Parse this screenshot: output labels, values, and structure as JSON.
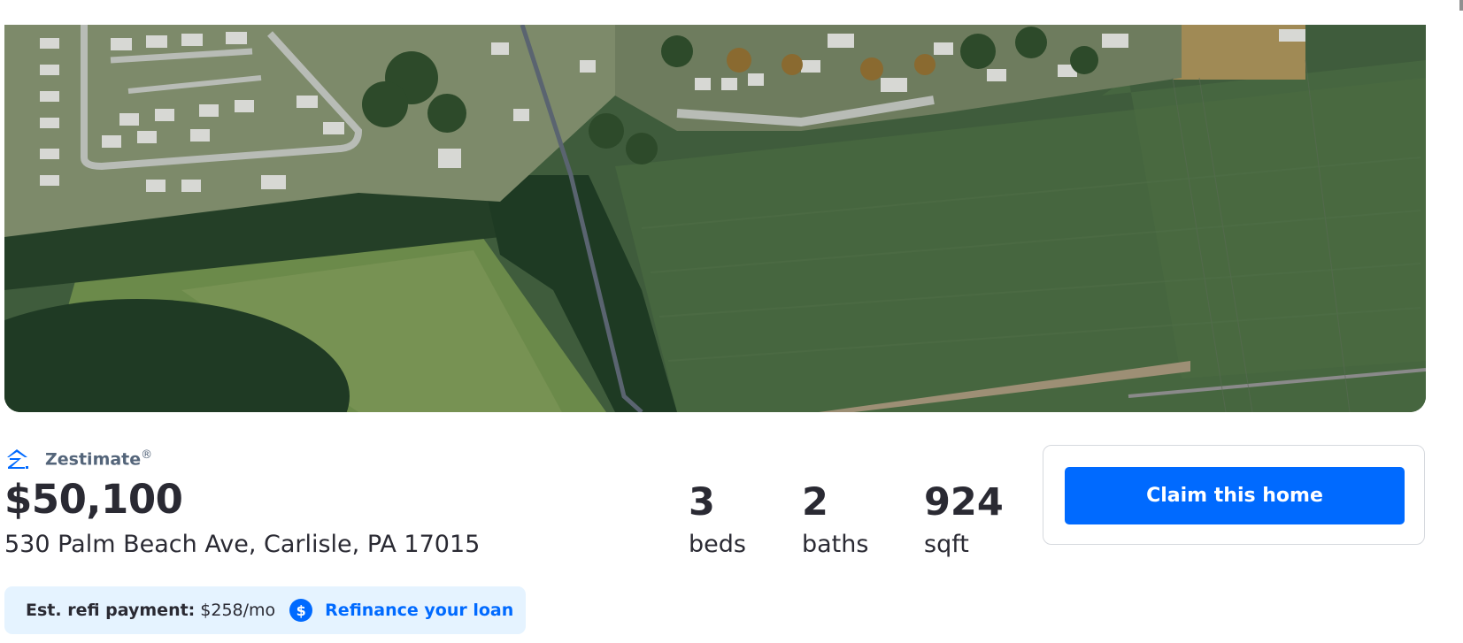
{
  "zestimate": {
    "label": "Zestimate",
    "reg_mark": "®",
    "price": "$50,100",
    "address": "530 Palm Beach Ave, Carlisle, PA 17015",
    "logo_icon": "zillow-logo-icon"
  },
  "facts": [
    {
      "value": "3",
      "label": "beds"
    },
    {
      "value": "2",
      "label": "baths"
    },
    {
      "value": "924",
      "label": "sqft"
    }
  ],
  "claim": {
    "button_label": "Claim this home"
  },
  "refi": {
    "label": "Est. refi payment:",
    "value": "$258/mo",
    "icon": "dollar-circle-icon",
    "icon_glyph": "$",
    "link_label": "Refinance your loan"
  },
  "colors": {
    "brand_blue": "#006aff",
    "refi_bg": "#e5f3ff",
    "zest_label": "#54657a",
    "text": "#2a2a33"
  },
  "hero": {
    "image": "aerial-satellite-photo"
  }
}
